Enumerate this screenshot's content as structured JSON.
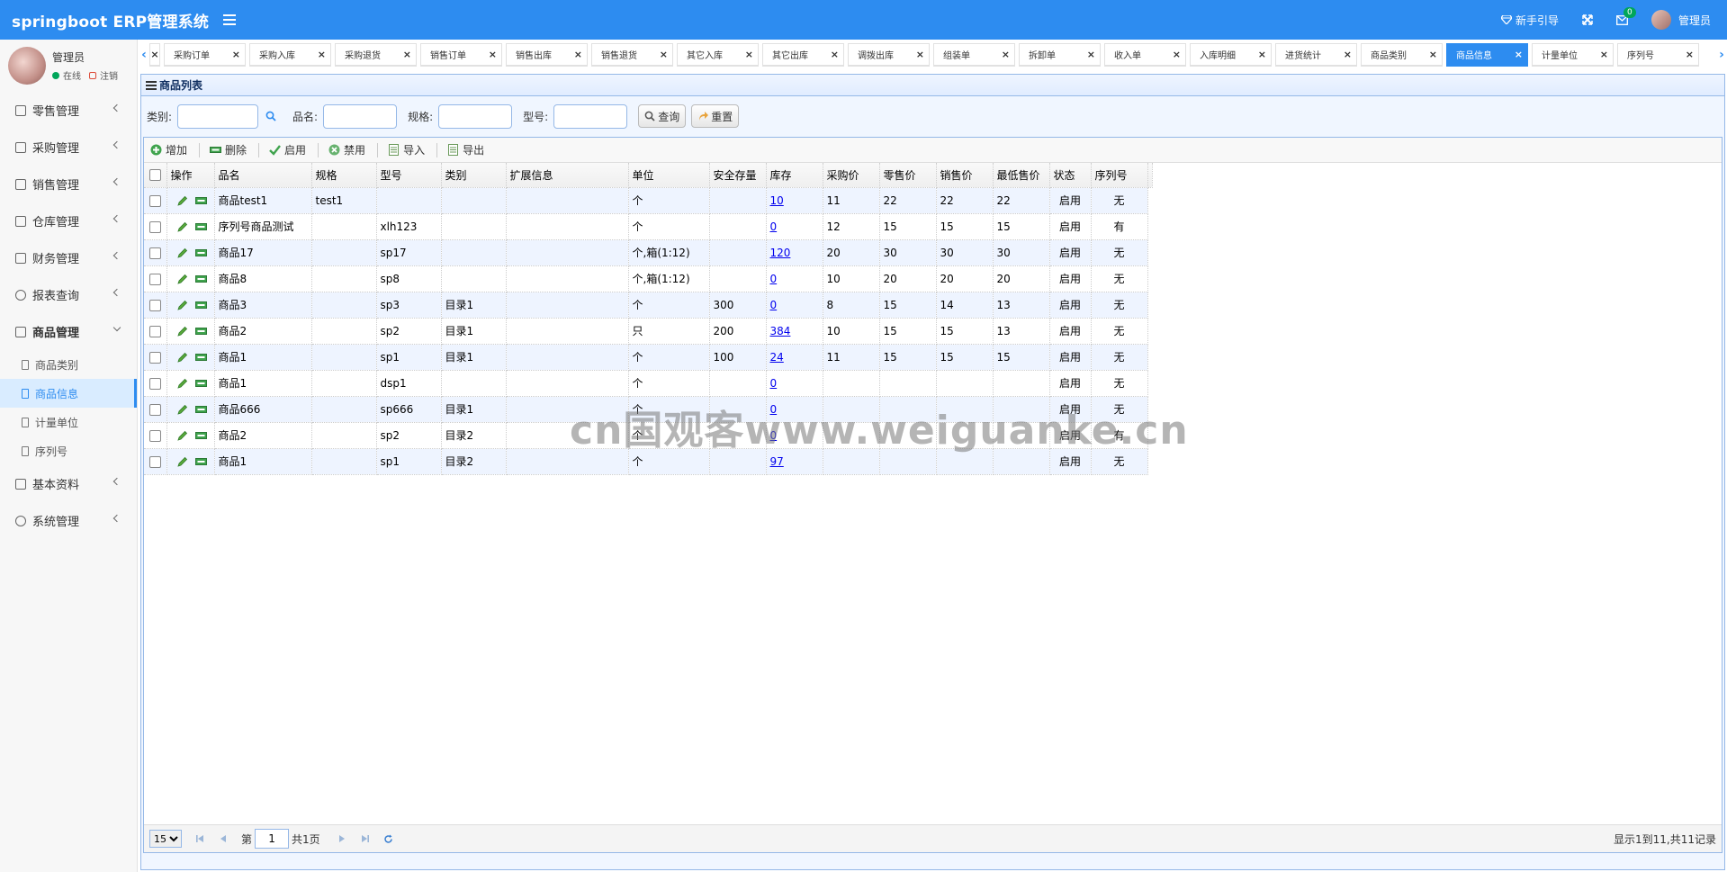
{
  "header": {
    "title": "springboot ERP管理系统",
    "guide": "新手引导",
    "message_count": "0",
    "user": "管理员",
    "accent": "#2d8cf0"
  },
  "sidebar": {
    "user_name": "管理员",
    "online": "在线",
    "logout": "注销",
    "menus": [
      {
        "label": "零售管理"
      },
      {
        "label": "采购管理"
      },
      {
        "label": "销售管理"
      },
      {
        "label": "仓库管理"
      },
      {
        "label": "财务管理"
      },
      {
        "label": "报表查询"
      },
      {
        "label": "商品管理"
      },
      {
        "label": "基本资料"
      },
      {
        "label": "系统管理"
      }
    ],
    "submenus": [
      {
        "label": "商品类别"
      },
      {
        "label": "商品信息"
      },
      {
        "label": "计量单位"
      },
      {
        "label": "序列号"
      }
    ]
  },
  "tabs": [
    "采购订单",
    "采购入库",
    "采购退货",
    "销售订单",
    "销售出库",
    "销售退货",
    "其它入库",
    "其它出库",
    "调拨出库",
    "组装单",
    "拆卸单",
    "收入单",
    "入库明细",
    "进货统计",
    "商品类别",
    "商品信息",
    "计量单位",
    "序列号"
  ],
  "panel": {
    "title": "商品列表"
  },
  "search": {
    "category_label": "类别:",
    "name_label": "品名:",
    "spec_label": "规格:",
    "model_label": "型号:",
    "query_btn": "查询",
    "reset_btn": "重置"
  },
  "toolbar": {
    "add": "增加",
    "delete": "删除",
    "enable": "启用",
    "disable": "禁用",
    "import": "导入",
    "export": "导出"
  },
  "table": {
    "headers": [
      "操作",
      "品名",
      "规格",
      "型号",
      "类别",
      "扩展信息",
      "单位",
      "安全存量",
      "库存",
      "采购价",
      "零售价",
      "销售价",
      "最低售价",
      "状态",
      "序列号"
    ],
    "rows": [
      [
        "商品test1",
        "test1",
        "",
        "",
        "",
        "个",
        "",
        "10",
        "11",
        "22",
        "22",
        "22",
        "启用",
        "无"
      ],
      [
        "序列号商品测试",
        "",
        "xlh123",
        "",
        "",
        "个",
        "",
        "0",
        "12",
        "15",
        "15",
        "15",
        "启用",
        "有"
      ],
      [
        "商品17",
        "",
        "sp17",
        "",
        "",
        "个,箱(1:12)",
        "",
        "120",
        "20",
        "30",
        "30",
        "30",
        "启用",
        "无"
      ],
      [
        "商品8",
        "",
        "sp8",
        "",
        "",
        "个,箱(1:12)",
        "",
        "0",
        "10",
        "20",
        "20",
        "20",
        "启用",
        "无"
      ],
      [
        "商品3",
        "",
        "sp3",
        "目录1",
        "",
        "个",
        "300",
        "0",
        "8",
        "15",
        "14",
        "13",
        "启用",
        "无"
      ],
      [
        "商品2",
        "",
        "sp2",
        "目录1",
        "",
        "只",
        "200",
        "384",
        "10",
        "15",
        "15",
        "13",
        "启用",
        "无"
      ],
      [
        "商品1",
        "",
        "sp1",
        "目录1",
        "",
        "个",
        "100",
        "24",
        "11",
        "15",
        "15",
        "15",
        "启用",
        "无"
      ],
      [
        "商品1",
        "",
        "dsp1",
        "",
        "",
        "个",
        "",
        "0",
        "",
        "",
        "",
        "",
        "启用",
        "无"
      ],
      [
        "商品666",
        "",
        "sp666",
        "目录1",
        "",
        "个",
        "",
        "0",
        "",
        "",
        "",
        "",
        "启用",
        "无"
      ],
      [
        "商品2",
        "",
        "sp2",
        "目录2",
        "",
        "个",
        "",
        "0",
        "",
        "",
        "",
        "",
        "启用",
        "有"
      ],
      [
        "商品1",
        "",
        "sp1",
        "目录2",
        "",
        "个",
        "",
        "97",
        "",
        "",
        "",
        "",
        "启用",
        "无"
      ]
    ]
  },
  "pager": {
    "page_size": "15",
    "page_prefix": "第",
    "page_value": "1",
    "page_suffix": "共1页",
    "info": "显示1到11,共11记录"
  },
  "watermark": "cn国观客www.weiguanke.cn"
}
